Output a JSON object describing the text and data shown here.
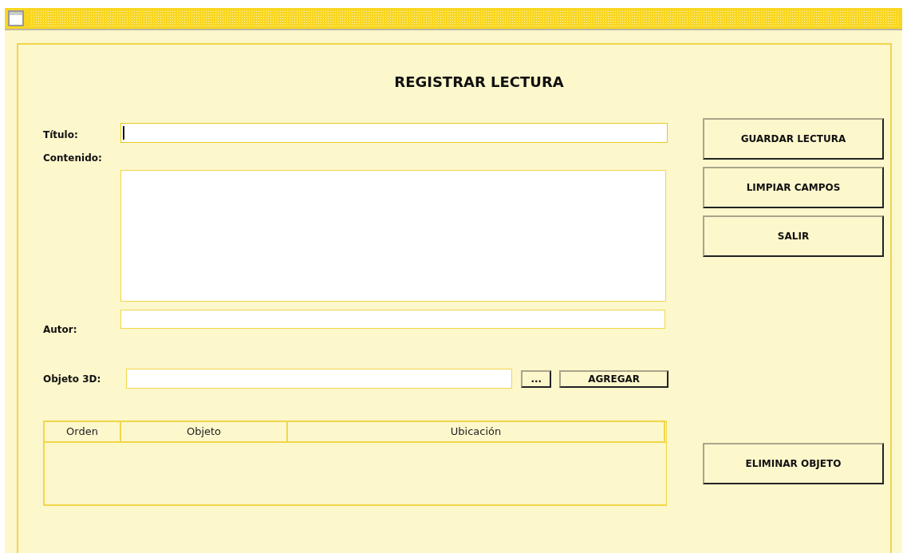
{
  "heading": "REGISTRAR LECTURA",
  "fields": [
    {
      "label": "Título:",
      "kind": "line",
      "focused": true
    },
    {
      "label": "Contenido:",
      "kind": "area",
      "focused": false
    },
    {
      "label": "Autor:",
      "kind": "line",
      "focused": false
    }
  ],
  "object_row": {
    "label": "Objeto 3D:",
    "browse": "...",
    "add": "AGREGAR"
  },
  "table": {
    "columns": [
      "Orden",
      "Objeto",
      "Ubicación"
    ]
  },
  "actions": [
    "GUARDAR LECTURA",
    "LIMPIAR CAMPOS",
    "SALIR"
  ],
  "table_actions": [
    "ELIMINAR OBJETO"
  ]
}
